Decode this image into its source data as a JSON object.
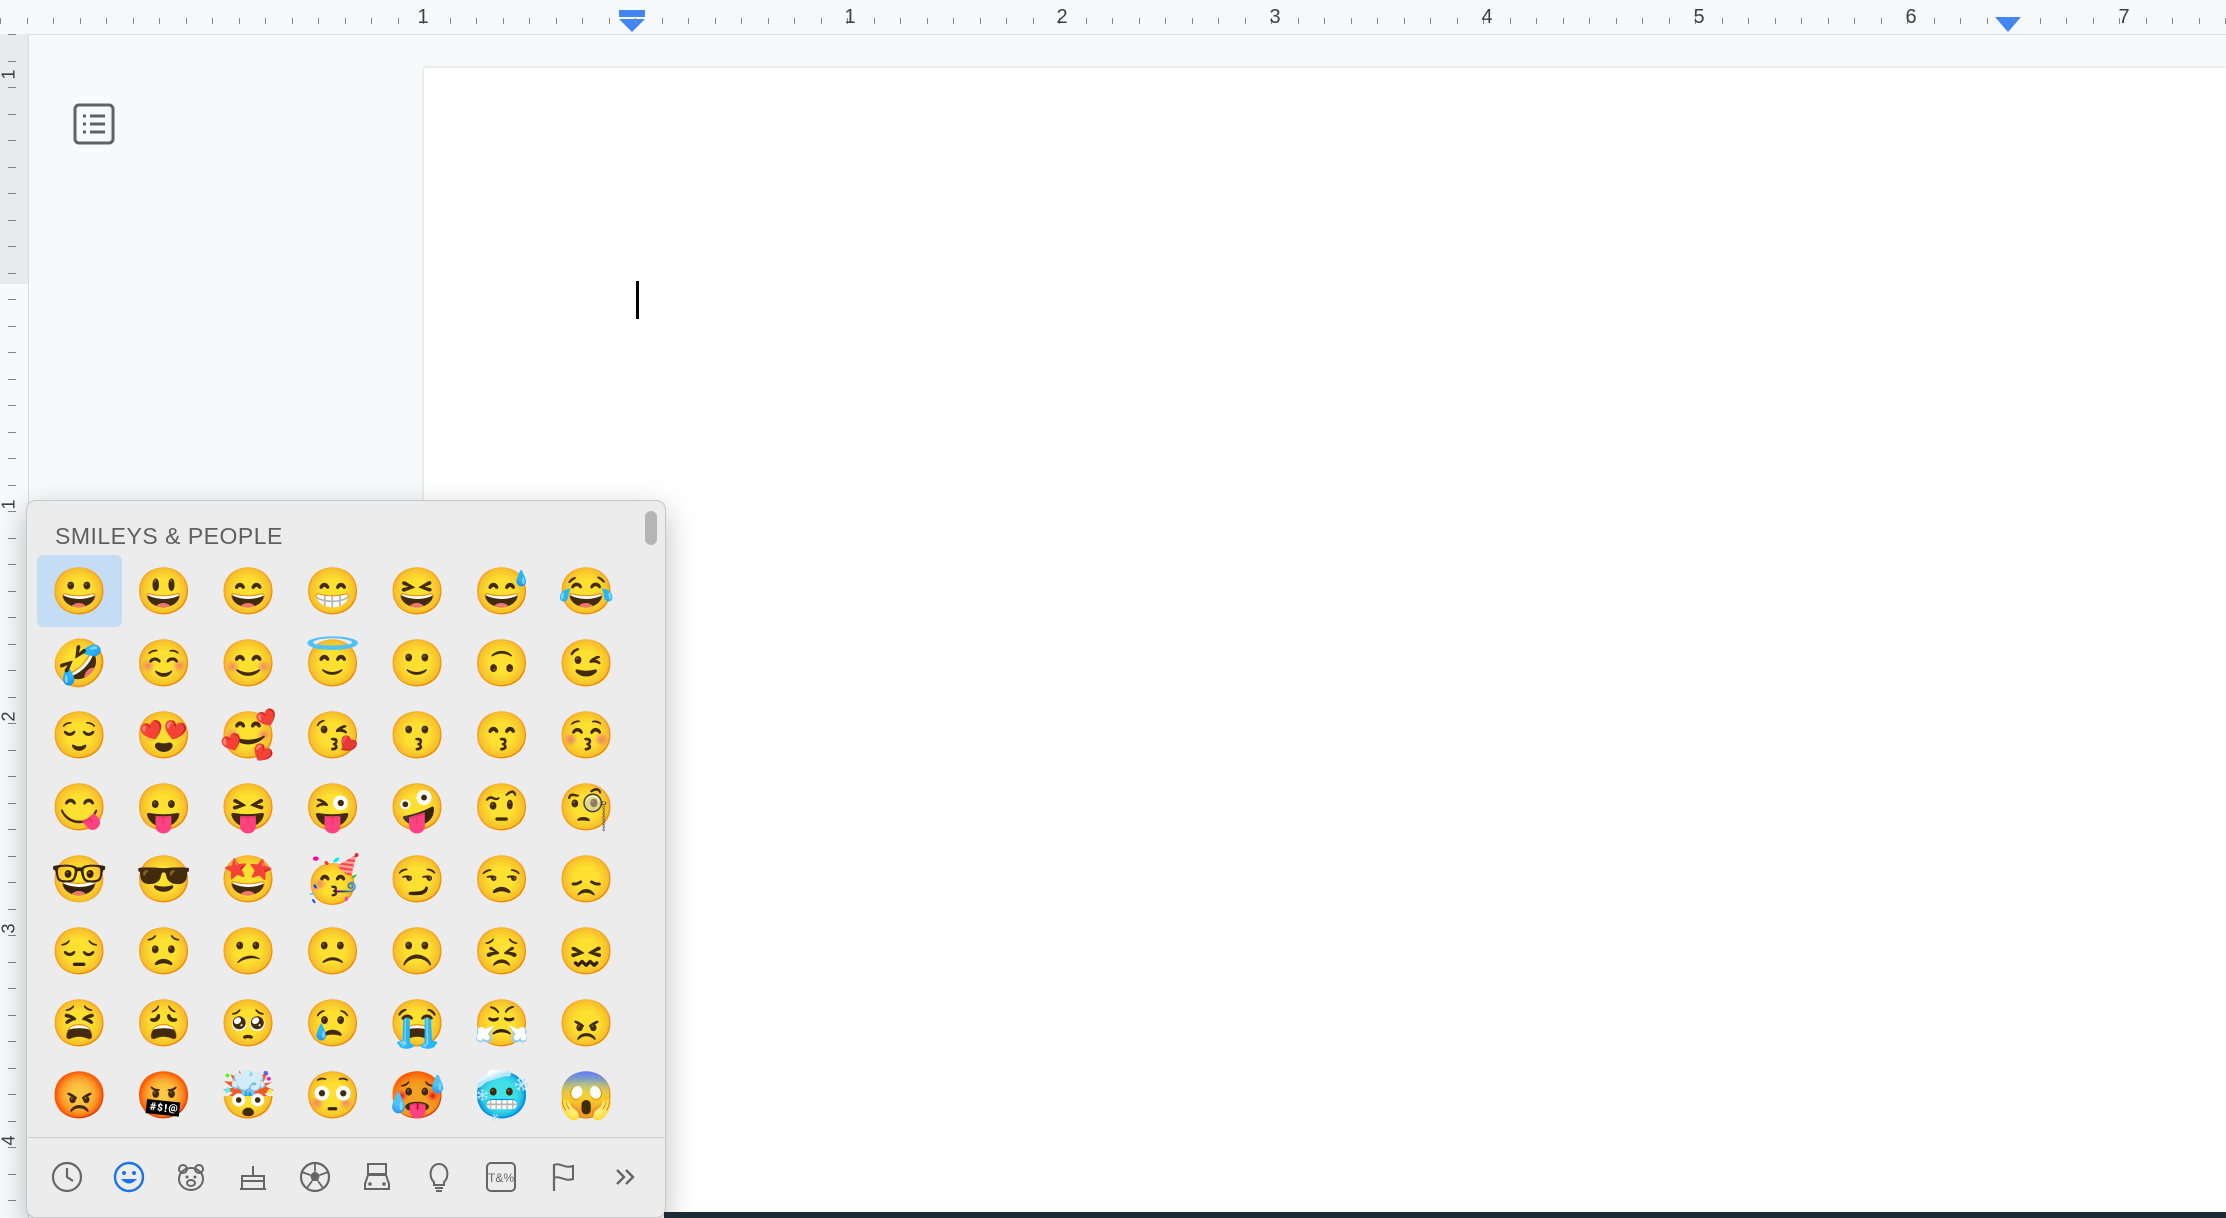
{
  "ruler": {
    "horizontal_numbers": [
      "1",
      "1",
      "2",
      "3",
      "4",
      "5",
      "6",
      "7"
    ],
    "vertical_numbers": [
      "1",
      "1",
      "2",
      "3",
      "4"
    ],
    "marker_color": "#4285f4"
  },
  "document": {
    "body_text": ""
  },
  "emoji_picker": {
    "section_title": "SMILEYS & PEOPLE",
    "emojis": [
      "😀",
      "😃",
      "😄",
      "😁",
      "😆",
      "😅",
      "😂",
      "🤣",
      "☺️",
      "😊",
      "😇",
      "🙂",
      "🙃",
      "😉",
      "😌",
      "😍",
      "🥰",
      "😘",
      "😗",
      "😙",
      "😚",
      "😋",
      "😛",
      "😝",
      "😜",
      "🤪",
      "🤨",
      "🧐",
      "🤓",
      "😎",
      "🤩",
      "🥳",
      "😏",
      "😒",
      "😞",
      "😔",
      "😟",
      "😕",
      "🙁",
      "☹️",
      "😣",
      "😖",
      "😫",
      "😩",
      "🥺",
      "😢",
      "😭",
      "😤",
      "😠",
      "😡",
      "🤬",
      "🤯",
      "😳",
      "🥵",
      "🥶",
      "😱"
    ],
    "selected_index": 0,
    "categories": [
      {
        "name": "frequently-used",
        "icon": "clock-icon"
      },
      {
        "name": "smileys-people",
        "icon": "smiley-icon",
        "active": true
      },
      {
        "name": "animals-nature",
        "icon": "bear-icon"
      },
      {
        "name": "food-drink",
        "icon": "cake-icon"
      },
      {
        "name": "activity",
        "icon": "soccer-ball-icon"
      },
      {
        "name": "travel-places",
        "icon": "car-icon"
      },
      {
        "name": "objects",
        "icon": "lightbulb-icon"
      },
      {
        "name": "symbols",
        "icon": "symbols-icon"
      },
      {
        "name": "flags",
        "icon": "flag-icon"
      },
      {
        "name": "more",
        "icon": "chevron-double-right-icon"
      }
    ],
    "symbols_icon_text": "T&%",
    "active_color": "#1a73e8"
  }
}
